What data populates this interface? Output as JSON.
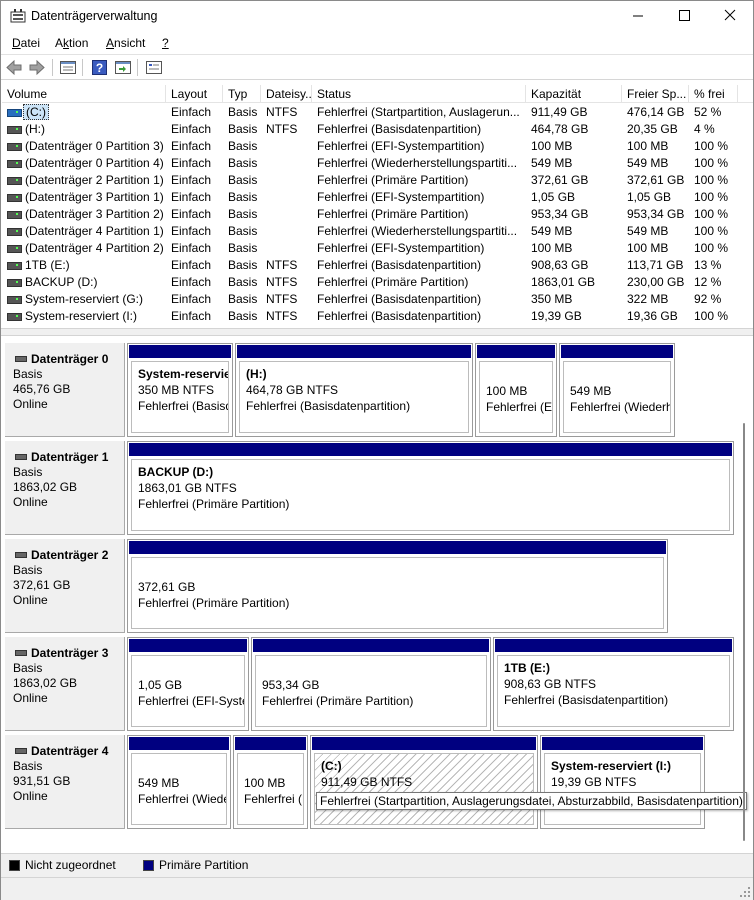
{
  "window": {
    "title": "Datenträgerverwaltung"
  },
  "menu": [
    {
      "text": "Datei",
      "key": "D",
      "rest": "atei"
    },
    {
      "text": "Aktion",
      "key": "k",
      "pre": "A",
      "rest": "tion"
    },
    {
      "text": "Ansicht",
      "key": "A",
      "rest": "nsicht"
    },
    {
      "text": "?",
      "key": "?",
      "rest": ""
    }
  ],
  "toolbar": [
    "back-icon",
    "forward-icon",
    "properties-icon",
    "help-icon",
    "refresh-icon",
    "rescan-icon"
  ],
  "columns": [
    "Volume",
    "Layout",
    "Typ",
    "Dateisy...",
    "Status",
    "Kapazität",
    "Freier Sp...",
    "% frei"
  ],
  "volumes": [
    {
      "name": "(C:)",
      "layout": "Einfach",
      "type": "Basis",
      "fs": "NTFS",
      "status": "Fehlerfrei (Startpartition, Auslagerun...",
      "capacity": "911,49 GB",
      "free": "476,14 GB",
      "pct": "52 %",
      "selected": true
    },
    {
      "name": "(H:)",
      "layout": "Einfach",
      "type": "Basis",
      "fs": "NTFS",
      "status": "Fehlerfrei (Basisdatenpartition)",
      "capacity": "464,78 GB",
      "free": "20,35 GB",
      "pct": "4 %"
    },
    {
      "name": "(Datenträger 0 Partition 3)",
      "layout": "Einfach",
      "type": "Basis",
      "fs": "",
      "status": "Fehlerfrei (EFI-Systempartition)",
      "capacity": "100 MB",
      "free": "100 MB",
      "pct": "100 %"
    },
    {
      "name": "(Datenträger 0 Partition 4)",
      "layout": "Einfach",
      "type": "Basis",
      "fs": "",
      "status": "Fehlerfrei (Wiederherstellungspartiti...",
      "capacity": "549 MB",
      "free": "549 MB",
      "pct": "100 %"
    },
    {
      "name": "(Datenträger 2 Partition 1)",
      "layout": "Einfach",
      "type": "Basis",
      "fs": "",
      "status": "Fehlerfrei (Primäre Partition)",
      "capacity": "372,61 GB",
      "free": "372,61 GB",
      "pct": "100 %"
    },
    {
      "name": "(Datenträger 3 Partition 1)",
      "layout": "Einfach",
      "type": "Basis",
      "fs": "",
      "status": "Fehlerfrei (EFI-Systempartition)",
      "capacity": "1,05 GB",
      "free": "1,05 GB",
      "pct": "100 %"
    },
    {
      "name": "(Datenträger 3 Partition 2)",
      "layout": "Einfach",
      "type": "Basis",
      "fs": "",
      "status": "Fehlerfrei (Primäre Partition)",
      "capacity": "953,34 GB",
      "free": "953,34 GB",
      "pct": "100 %"
    },
    {
      "name": "(Datenträger 4 Partition 1)",
      "layout": "Einfach",
      "type": "Basis",
      "fs": "",
      "status": "Fehlerfrei (Wiederherstellungspartiti...",
      "capacity": "549 MB",
      "free": "549 MB",
      "pct": "100 %"
    },
    {
      "name": "(Datenträger 4 Partition 2)",
      "layout": "Einfach",
      "type": "Basis",
      "fs": "",
      "status": "Fehlerfrei (EFI-Systempartition)",
      "capacity": "100 MB",
      "free": "100 MB",
      "pct": "100 %"
    },
    {
      "name": "1TB (E:)",
      "layout": "Einfach",
      "type": "Basis",
      "fs": "NTFS",
      "status": "Fehlerfrei (Basisdatenpartition)",
      "capacity": "908,63 GB",
      "free": "113,71 GB",
      "pct": "13 %"
    },
    {
      "name": "BACKUP (D:)",
      "layout": "Einfach",
      "type": "Basis",
      "fs": "NTFS",
      "status": "Fehlerfrei (Primäre Partition)",
      "capacity": "1863,01 GB",
      "free": "230,00 GB",
      "pct": "12 %"
    },
    {
      "name": "System-reserviert (G:)",
      "layout": "Einfach",
      "type": "Basis",
      "fs": "NTFS",
      "status": "Fehlerfrei (Basisdatenpartition)",
      "capacity": "350 MB",
      "free": "322 MB",
      "pct": "92 %"
    },
    {
      "name": "System-reserviert (I:)",
      "layout": "Einfach",
      "type": "Basis",
      "fs": "NTFS",
      "status": "Fehlerfrei (Basisdatenpartition)",
      "capacity": "19,39 GB",
      "free": "19,36 GB",
      "pct": "100 %"
    }
  ],
  "disks": [
    {
      "name": "Datenträger 0",
      "type": "Basis",
      "size": "465,76 GB",
      "state": "Online",
      "partitions": [
        {
          "name": "System-reservie",
          "line1": "350 MB NTFS",
          "line2": "Fehlerfrei (Basisda"
        },
        {
          "name": "(H:)",
          "line1": "464,78 GB NTFS",
          "line2": "Fehlerfrei (Basisdatenpartition)"
        },
        {
          "name": "",
          "line1": "100 MB",
          "line2": "Fehlerfrei (EF"
        },
        {
          "name": "",
          "line1": "549 MB",
          "line2": "Fehlerfrei (Wiederh"
        }
      ]
    },
    {
      "name": "Datenträger 1",
      "type": "Basis",
      "size": "1863,02 GB",
      "state": "Online",
      "partitions": [
        {
          "name": "BACKUP  (D:)",
          "line1": "1863,01 GB NTFS",
          "line2": "Fehlerfrei (Primäre Partition)"
        }
      ]
    },
    {
      "name": "Datenträger 2",
      "type": "Basis",
      "size": "372,61 GB",
      "state": "Online",
      "partitions": [
        {
          "name": "",
          "line1": "372,61 GB",
          "line2": "Fehlerfrei (Primäre Partition)"
        }
      ]
    },
    {
      "name": "Datenträger 3",
      "type": "Basis",
      "size": "1863,02 GB",
      "state": "Online",
      "partitions": [
        {
          "name": "",
          "line1": "1,05 GB",
          "line2": "Fehlerfrei (EFI-Syster"
        },
        {
          "name": "",
          "line1": "953,34 GB",
          "line2": "Fehlerfrei (Primäre Partition)"
        },
        {
          "name": "1TB  (E:)",
          "line1": "908,63 GB NTFS",
          "line2": "Fehlerfrei (Basisdatenpartition)"
        }
      ]
    },
    {
      "name": "Datenträger 4",
      "type": "Basis",
      "size": "931,51 GB",
      "state": "Online",
      "partitions": [
        {
          "name": "",
          "line1": "549 MB",
          "line2": "Fehlerfrei (Wiede"
        },
        {
          "name": "",
          "line1": "100 MB",
          "line2": "Fehlerfrei (E"
        },
        {
          "name": "(C:)",
          "line1": "911,49 GB NTFS",
          "line2": "",
          "selected": true
        },
        {
          "name": "System-reserviert  (I:)",
          "line1": "19,39 GB NTFS",
          "line2": ""
        }
      ]
    }
  ],
  "tooltip": "Fehlerfrei (Startpartition, Auslagerungsdatei, Absturzabbild, Basisdatenpartition)",
  "legend": [
    {
      "label": "Nicht zugeordnet",
      "color": "#000000"
    },
    {
      "label": "Primäre Partition",
      "color": "#000080"
    }
  ]
}
